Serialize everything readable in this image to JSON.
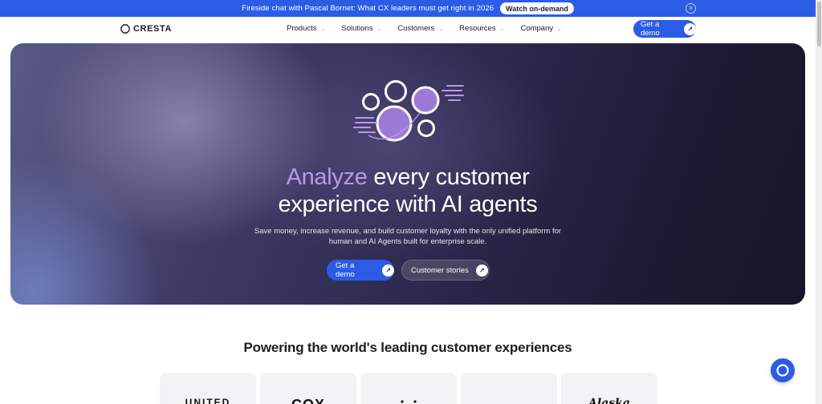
{
  "banner": {
    "text": "Fireside chat with Pascal Bornet: What CX leaders must get right in 2026",
    "button": "Watch on-demand",
    "close_icon": "close-icon"
  },
  "nav": {
    "logo": "CRESTA",
    "items": [
      {
        "label": "Products"
      },
      {
        "label": "Solutions"
      },
      {
        "label": "Customers"
      },
      {
        "label": "Resources"
      },
      {
        "label": "Company"
      }
    ],
    "cta": "Get a demo",
    "chevron_icon": "chevron-down-icon",
    "arrow_icon": "arrow-up-right-icon"
  },
  "hero": {
    "title_accent": "Analyze",
    "title_rest": " every customer",
    "title_line2": "experience with AI agents",
    "subtitle": "Save money, increase revenue, and build customer loyalty with the only unified platform for human and AI Agents built for enterprise scale.",
    "primary_button": "Get a demo",
    "secondary_button": "Customer stories",
    "accent_color": "#b79ae6",
    "brand_color": "#2b5ce6"
  },
  "customers": {
    "heading": "Powering the world's leading customer experiences",
    "logos": [
      "UNITED",
      "COX",
      "",
      "",
      "Alaska"
    ]
  },
  "chat_widget": {
    "icon": "chat-icon"
  }
}
